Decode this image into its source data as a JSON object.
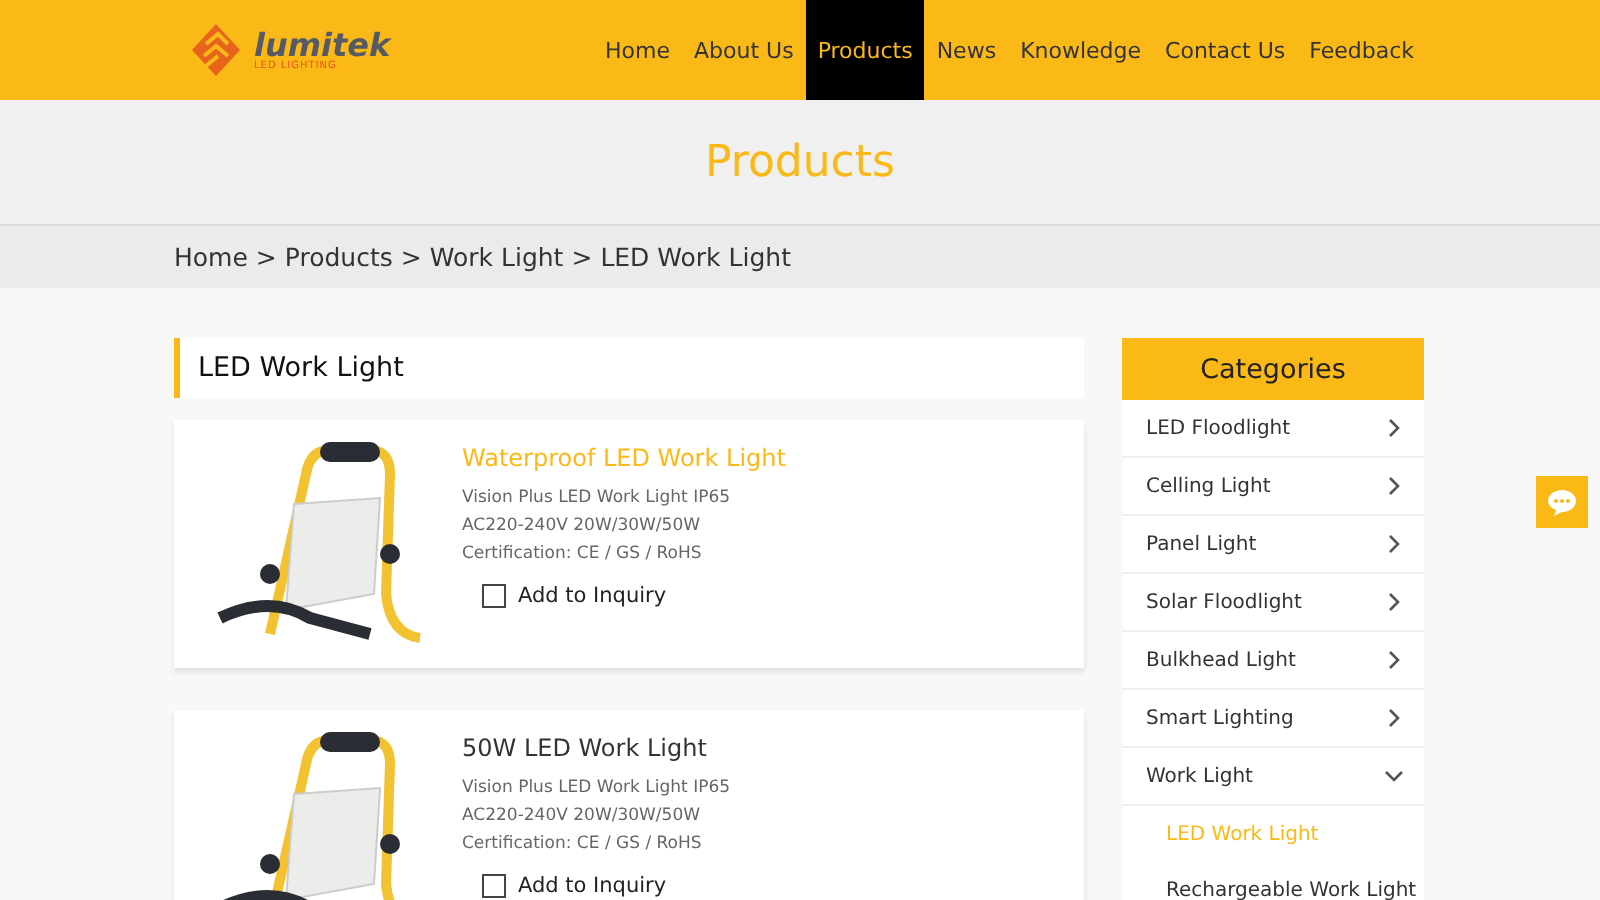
{
  "logo": {
    "name": "lumitek",
    "tagline": "LED LIGHTING"
  },
  "nav": [
    {
      "label": "Home",
      "selected": false
    },
    {
      "label": "About Us",
      "selected": false
    },
    {
      "label": "Products",
      "selected": true
    },
    {
      "label": "News",
      "selected": false
    },
    {
      "label": "Knowledge",
      "selected": false
    },
    {
      "label": "Contact Us",
      "selected": false
    },
    {
      "label": "Feedback",
      "selected": false
    }
  ],
  "banner": {
    "title": "Products"
  },
  "breadcrumb": {
    "separator": ">",
    "items": [
      "Home",
      "Products",
      "Work Light",
      "LED Work Light"
    ]
  },
  "section_title": "LED Work Light",
  "products": [
    {
      "title": "Waterproof LED Work Light",
      "highlighted": true,
      "lines": [
        "Vision Plus LED Work Light IP65",
        "AC220-240V 20W/30W/50W",
        "Certification: CE / GS / RoHS"
      ],
      "inquiry": {
        "label": "Add to Inquiry",
        "checked": false
      }
    },
    {
      "title": "50W LED Work Light",
      "highlighted": false,
      "lines": [
        "Vision Plus LED Work Light IP65",
        "AC220-240V 20W/30W/50W",
        "Certification: CE / GS / RoHS"
      ],
      "inquiry": {
        "label": "Add to Inquiry",
        "checked": false
      }
    }
  ],
  "sidebar": {
    "title": "Categories",
    "items": [
      {
        "label": "LED Floodlight",
        "expanded": false
      },
      {
        "label": "Celling Light",
        "expanded": false
      },
      {
        "label": "Panel Light",
        "expanded": false
      },
      {
        "label": "Solar Floodlight",
        "expanded": false
      },
      {
        "label": "Bulkhead Light",
        "expanded": false
      },
      {
        "label": "Smart Lighting",
        "expanded": false
      },
      {
        "label": "Work Light",
        "expanded": true,
        "children": [
          {
            "label": "LED Work Light",
            "selected": true
          },
          {
            "label": "Rechargeable Work Light",
            "selected": false
          }
        ]
      }
    ]
  }
}
